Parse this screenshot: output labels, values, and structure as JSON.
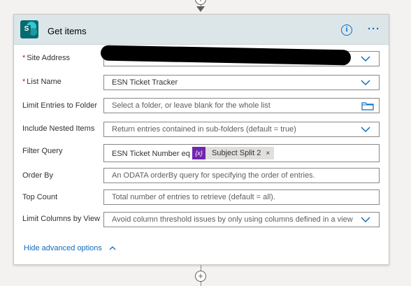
{
  "card": {
    "title": "Get items",
    "icon": "sharepoint-icon",
    "icon_letter": "S",
    "accent": "#036c70",
    "header_bg": "#dce6e9",
    "link_color": "#0f6cbd"
  },
  "fields": {
    "site_address": {
      "label": "Site Address",
      "required": true,
      "value": ""
    },
    "list_name": {
      "label": "List Name",
      "required": true,
      "value": "ESN Ticket Tracker"
    },
    "limit_folder": {
      "label": "Limit Entries to Folder",
      "placeholder": "Select a folder, or leave blank for the whole list"
    },
    "include_nested": {
      "label": "Include Nested Items",
      "placeholder": "Return entries contained in sub-folders (default = true)"
    },
    "filter_query": {
      "label": "Filter Query",
      "value_prefix": "ESN Ticket Number eq '",
      "token_icon": "{x}",
      "token_label": "Subject Split 2",
      "token_remove": "×"
    },
    "order_by": {
      "label": "Order By",
      "placeholder": "An ODATA orderBy query for specifying the order of entries."
    },
    "top_count": {
      "label": "Top Count",
      "placeholder": "Total number of entries to retrieve (default = all)."
    },
    "limit_columns": {
      "label": "Limit Columns by View",
      "placeholder": "Avoid column threshold issues by only using columns defined in a view"
    }
  },
  "advanced": {
    "label": "Hide advanced options"
  },
  "connectors": {
    "add_step_symbol": "+"
  }
}
